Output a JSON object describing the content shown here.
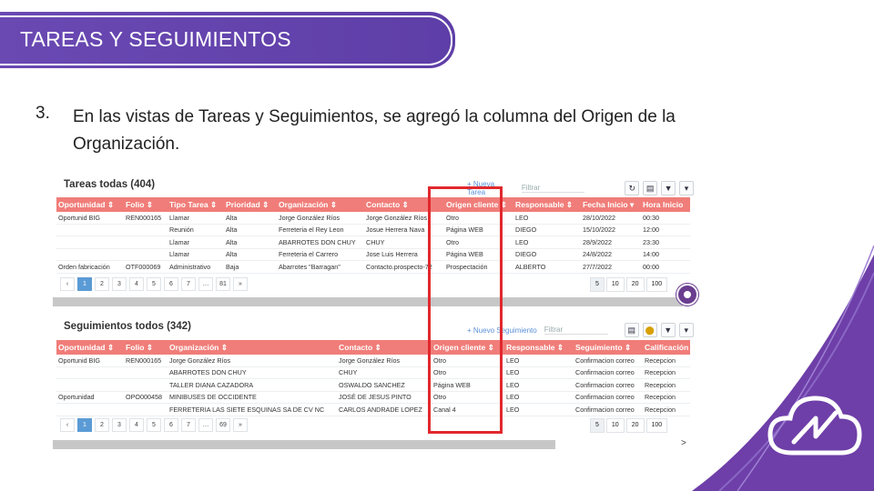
{
  "banner": {
    "title": "TAREAS Y SEGUIMIENTOS"
  },
  "point": {
    "number": "3.",
    "text": "En las vistas de Tareas y Seguimientos, se agregó la columna del Origen de la Organización."
  },
  "tasks": {
    "title": "Tareas todas (404)",
    "new_link": "+ Nueva Tarea",
    "filter_placeholder": "Filtrar",
    "columns": [
      "Oportunidad ⇕",
      "Folio ⇕",
      "Tipo Tarea ⇕",
      "Prioridad ⇕",
      "Organización ⇕",
      "Contacto ⇕",
      "Origen cliente ⇕",
      "Responsable ⇕",
      "Fecha Inicio ▾",
      "Hora Inicio"
    ],
    "rows": [
      [
        "Oportunid BIG",
        "REN000165",
        "Llamar",
        "Alta",
        "Jorge González Ríos",
        "Jorge González Ríos",
        "Otro",
        "LEO",
        "28/10/2022",
        "00:30"
      ],
      [
        "",
        "",
        "Reunión",
        "Alta",
        "Ferreteria el Rey Leon",
        "Josue Herrera Nava",
        "Página WEB",
        "DIEGO",
        "15/10/2022",
        "12:00"
      ],
      [
        "",
        "",
        "Llamar",
        "Alta",
        "ABARROTES DON CHUY",
        "CHUY",
        "Otro",
        "LEO",
        "28/9/2022",
        "23:30"
      ],
      [
        "",
        "",
        "Llamar",
        "Alta",
        "Ferreteria el Carrero",
        "Jose Luis Herrera",
        "Página WEB",
        "DIEGO",
        "24/8/2022",
        "14:00"
      ],
      [
        "Orden fabricación",
        "OTF000069",
        "Administrativo",
        "Baja",
        "Abarrotes \"Barragan\"",
        "Contacto.prospecto-72",
        "Prospectación",
        "ALBERTO",
        "27/7/2022",
        "00:00"
      ]
    ],
    "pager": [
      "‹",
      "1",
      "2",
      "3",
      "4",
      "5",
      "6",
      "7",
      "…",
      "81",
      "»"
    ],
    "sizes": [
      "5",
      "10",
      "20",
      "100"
    ]
  },
  "followups": {
    "title": "Seguimientos todos (342)",
    "new_link": "+ Nuevo Seguimiento",
    "filter_placeholder": "Filtrar",
    "columns": [
      "Oportunidad ⇕",
      "Folio ⇕",
      "Organización ⇕",
      "Contacto ⇕",
      "Origen cliente ⇕",
      "Responsable ⇕",
      "Seguimiento ⇕",
      "Calificación"
    ],
    "rows": [
      [
        "Oportunid BIG",
        "REN000165",
        "Jorge González Ríos",
        "Jorge González Ríos",
        "Otro",
        "LEO",
        "Confirmacion correo",
        "Recepcion"
      ],
      [
        "",
        "",
        "ABARROTES DON CHUY",
        "CHUY",
        "Otro",
        "LEO",
        "Confirmacion correo",
        "Recepcion"
      ],
      [
        "",
        "",
        "TALLER DIANA CAZADORA",
        "OSWALDO SANCHEZ",
        "Página WEB",
        "LEO",
        "Confirmacion correo",
        "Recepcion"
      ],
      [
        "Oportunidad",
        "OPO000458",
        "MINIBUSES DE OCCIDENTE",
        "JOSÉ DE JESUS PINTO",
        "Otro",
        "LEO",
        "Confirmacion correo",
        "Recepcion"
      ],
      [
        "",
        "",
        "FERRETERIA LAS SIETE ESQUINAS SA DE CV NC",
        "CARLOS ANDRADE LOPEZ",
        "Canal 4",
        "LEO",
        "Confirmacion correo",
        "Recepcion"
      ]
    ],
    "pager": [
      "‹",
      "1",
      "2",
      "3",
      "4",
      "5",
      "6",
      "7",
      "…",
      "69",
      "»"
    ],
    "sizes": [
      "5",
      "10",
      "20",
      "100"
    ],
    "scroll_arrow": ">"
  },
  "colors": {
    "banner": "#6a49b3",
    "header_row": "#f07d79",
    "highlight": "#e1282d",
    "link": "#4f86d6"
  }
}
